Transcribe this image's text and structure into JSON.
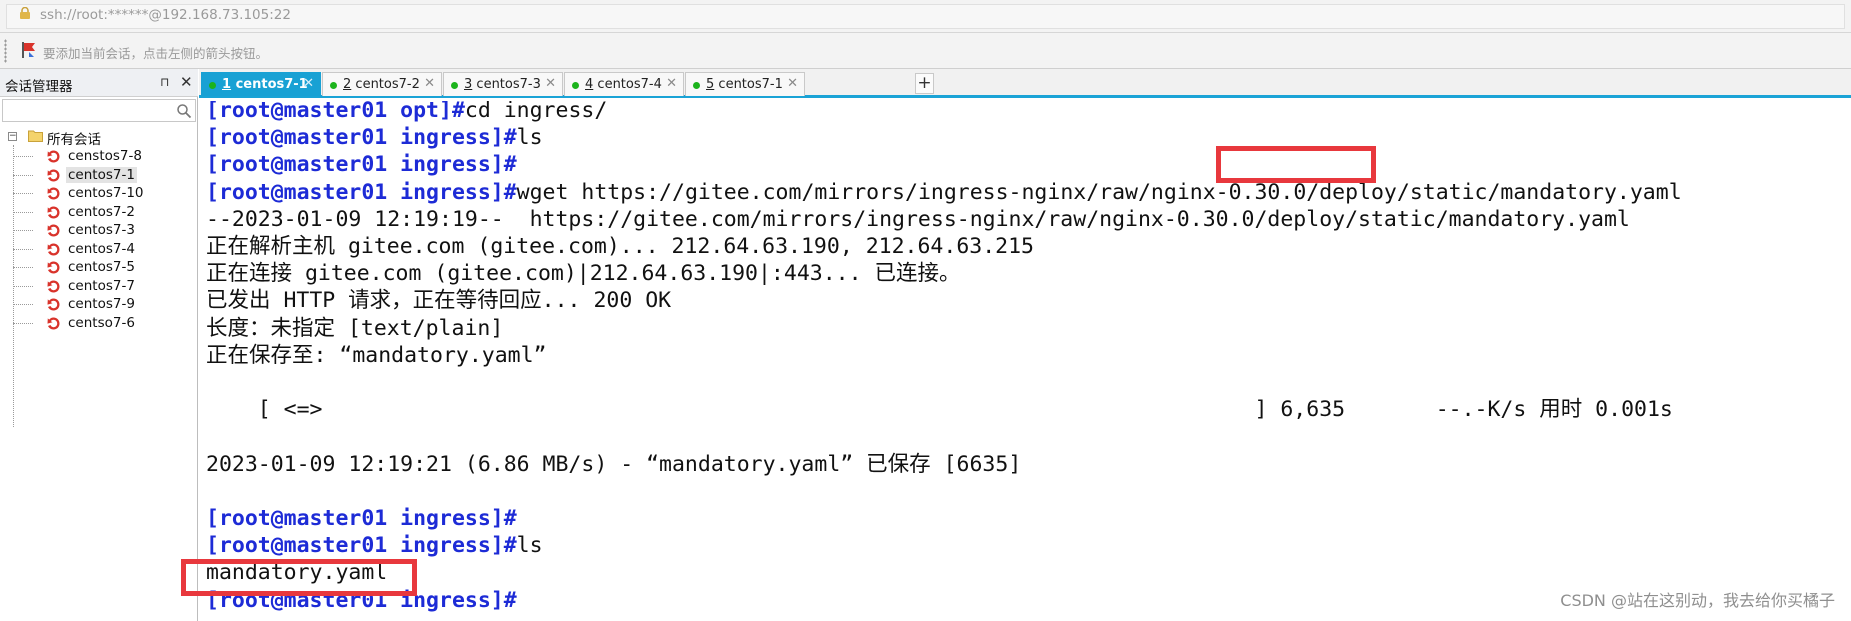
{
  "address_bar": {
    "text": "ssh://root:******@192.168.73.105:22"
  },
  "hint_bar": {
    "text": "要添加当前会话，点击左侧的箭头按钮。"
  },
  "session_panel": {
    "title": "会话管理器",
    "pin_glyph": "⊓",
    "close_glyph": "✕",
    "root_label": "所有会话",
    "items": [
      {
        "label": "censtos7-8"
      },
      {
        "label": "centos7-1"
      },
      {
        "label": "centos7-10"
      },
      {
        "label": "centos7-2"
      },
      {
        "label": "centos7-3"
      },
      {
        "label": "centos7-4"
      },
      {
        "label": "centos7-5"
      },
      {
        "label": "centos7-7"
      },
      {
        "label": "centos7-9"
      },
      {
        "label": "centso7-6"
      }
    ],
    "selected_item": "centos7-1"
  },
  "tabs": [
    {
      "num": "1",
      "label": "centos7-1",
      "active": true
    },
    {
      "num": "2",
      "label": "centos7-2",
      "active": false
    },
    {
      "num": "3",
      "label": "centos7-3",
      "active": false
    },
    {
      "num": "4",
      "label": "centos7-4",
      "active": false
    },
    {
      "num": "5",
      "label": "centos7-1",
      "active": false
    }
  ],
  "tab_close_glyph": "✕",
  "new_tab_glyph": "+",
  "terminal": {
    "lines": [
      {
        "prompt": "[root@master01 opt]#",
        "text": "cd ingress/"
      },
      {
        "prompt": "[root@master01 ingress]#",
        "text": "ls"
      },
      {
        "prompt": "[root@master01 ingress]#",
        "text": ""
      },
      {
        "prompt": "[root@master01 ingress]#",
        "text": "wget https://gitee.com/mirrors/ingress-nginx/raw/nginx-0.30.0/deploy/static/mandatory.yaml"
      },
      {
        "prompt": "",
        "text": "--2023-01-09 12:19:19--  https://gitee.com/mirrors/ingress-nginx/raw/nginx-0.30.0/deploy/static/mandatory.yaml"
      },
      {
        "prompt": "",
        "text": "正在解析主机 gitee.com (gitee.com)... 212.64.63.190, 212.64.63.215"
      },
      {
        "prompt": "",
        "text": "正在连接 gitee.com (gitee.com)|212.64.63.190|:443... 已连接。"
      },
      {
        "prompt": "",
        "text": "已发出 HTTP 请求，正在等待回应... 200 OK"
      },
      {
        "prompt": "",
        "text": "长度：未指定 [text/plain]"
      },
      {
        "prompt": "",
        "text": "正在保存至: “mandatory.yaml”"
      },
      {
        "prompt": "",
        "text": ""
      },
      {
        "prompt": "",
        "text": "    [ <=>                                                                        ] 6,635       --.-K/s 用时 0.001s"
      },
      {
        "prompt": "",
        "text": ""
      },
      {
        "prompt": "",
        "text": "2023-01-09 12:19:21 (6.86 MB/s) - “mandatory.yaml” 已保存 [6635]"
      },
      {
        "prompt": "",
        "text": ""
      },
      {
        "prompt": "[root@master01 ingress]#",
        "text": ""
      },
      {
        "prompt": "[root@master01 ingress]#",
        "text": "ls"
      },
      {
        "prompt": "",
        "text": "mandatory.yaml"
      },
      {
        "prompt": "[root@master01 ingress]#",
        "text": ""
      }
    ]
  },
  "highlights": [
    {
      "label": "version-highlight",
      "text": "nginx-0.30.0"
    },
    {
      "label": "file-highlight",
      "text": "mandatory.yaml"
    }
  ],
  "watermark": "CSDN @站在这别动，我去给你买橘子",
  "colors": {
    "prompt": "#1d2bd6",
    "active_tab": "#19a1d4",
    "highlight": "#e8383d",
    "session_icon": "#d9332b",
    "tab_dot": "#1bb31b"
  }
}
